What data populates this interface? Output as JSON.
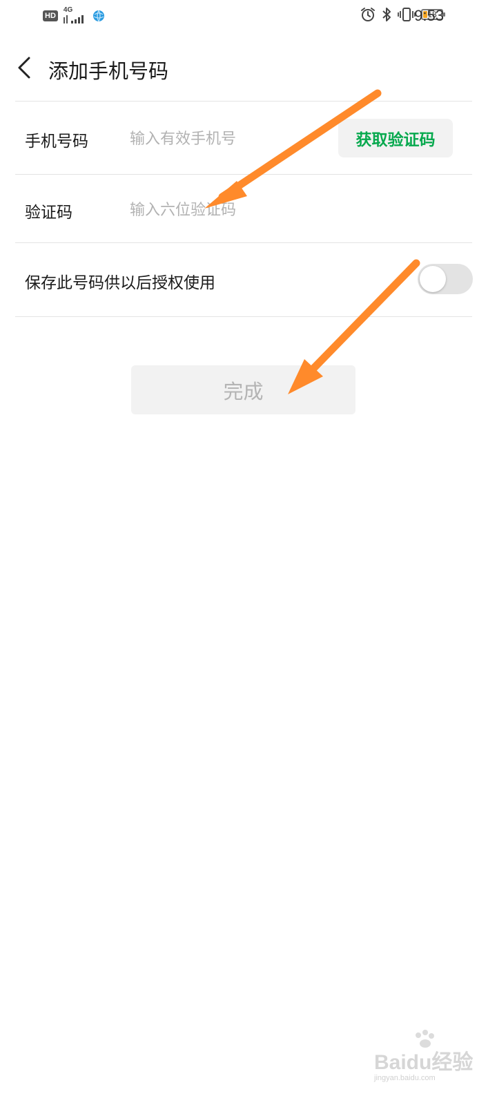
{
  "status_bar": {
    "hd_label": "HD",
    "network_label": "4G",
    "battery_level": "18",
    "time": "9:53",
    "icons": [
      "hd-icon",
      "signal-icon",
      "vpn-globe-icon",
      "alarm-icon",
      "bluetooth-icon",
      "vibrate-icon",
      "battery-icon"
    ]
  },
  "header": {
    "back_icon": "chevron-left-icon",
    "title": "添加手机号码"
  },
  "form": {
    "phone": {
      "label": "手机号码",
      "value": "",
      "placeholder": "输入有效手机号",
      "get_code_label": "获取验证码"
    },
    "code": {
      "label": "验证码",
      "value": "",
      "placeholder": "输入六位验证码"
    },
    "save": {
      "label": "保存此号码供以后授权使用",
      "enabled": false
    }
  },
  "done_button": {
    "label": "完成"
  },
  "colors": {
    "accent_green": "#07a94e",
    "annotation_orange": "#ff8a2b",
    "divider": "#e3e3e3",
    "disabled_bg": "#f2f2f2"
  },
  "watermark": {
    "text": "Baidu经验",
    "subtext": "jingyan.baidu.com"
  }
}
